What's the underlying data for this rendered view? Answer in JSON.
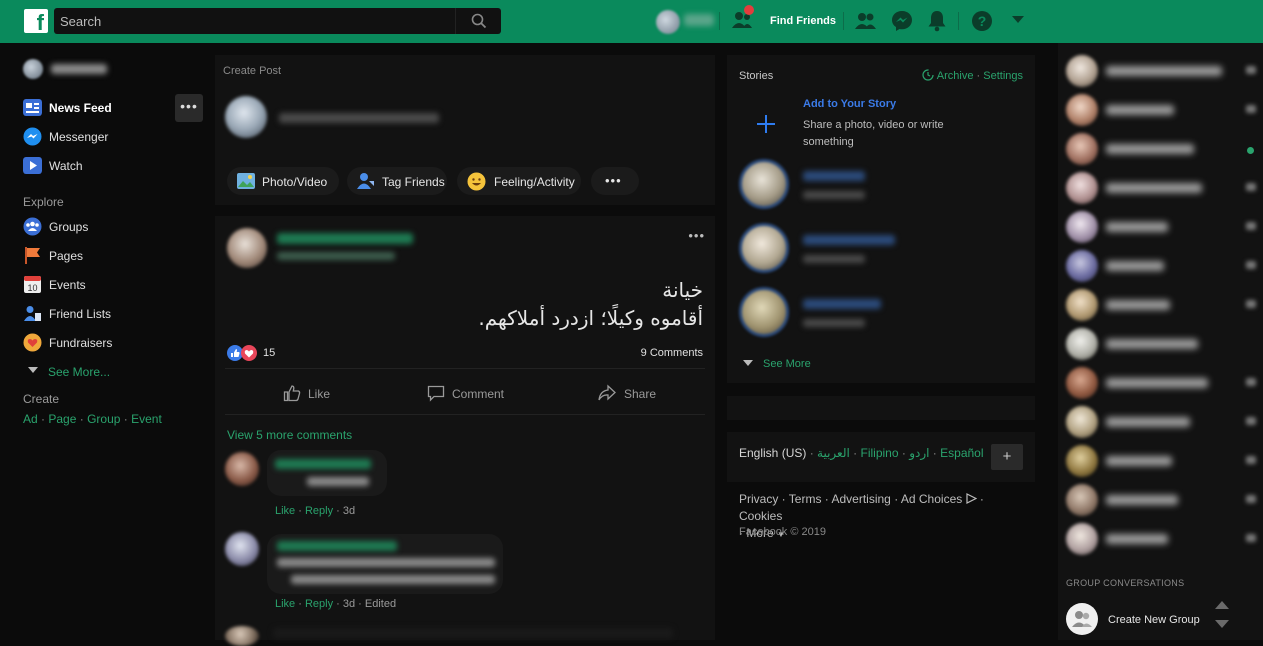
{
  "topbar": {
    "logo": "f",
    "search_placeholder": "Search",
    "find_friends": "Find Friends",
    "icons": [
      "friend-requests-icon",
      "messenger-icon",
      "notifications-icon",
      "help-icon",
      "dropdown-caret-icon"
    ],
    "colors": {
      "bar": "#0a8a5c",
      "badge": "#e23d3d"
    }
  },
  "left_sidebar": {
    "items": [
      {
        "label": "News Feed",
        "icon": "news-feed-icon"
      },
      {
        "label": "Messenger",
        "icon": "messenger-icon"
      },
      {
        "label": "Watch",
        "icon": "watch-icon"
      }
    ],
    "explore_title": "Explore",
    "explore": [
      {
        "label": "Groups",
        "icon": "groups-icon"
      },
      {
        "label": "Pages",
        "icon": "pages-flag-icon"
      },
      {
        "label": "Events",
        "icon": "events-calendar-icon"
      },
      {
        "label": "Friend Lists",
        "icon": "friend-lists-icon"
      },
      {
        "label": "Fundraisers",
        "icon": "fundraisers-icon"
      }
    ],
    "see_more": "See More...",
    "create_title": "Create",
    "create_links": [
      "Ad",
      "Page",
      "Group",
      "Event"
    ],
    "more_dots": "•••"
  },
  "create_post": {
    "title": "Create Post",
    "actions": [
      "Photo/Video",
      "Tag Friends",
      "Feeling/Activity"
    ],
    "more": "•••"
  },
  "post": {
    "text_line1": "خيانة",
    "text_line2": "أقاموه وكيلًا؛ ازدرد أملاكهم.",
    "reactions_count": "15",
    "comments_count": "9 Comments",
    "actions": [
      "Like",
      "Comment",
      "Share"
    ],
    "more": "•••",
    "view_more_comments": "View 5 more comments",
    "comments": [
      {
        "like": "Like",
        "reply": "Reply",
        "time": "3d",
        "edited": ""
      },
      {
        "like": "Like",
        "reply": "Reply",
        "time": "3d",
        "edited": "Edited"
      }
    ]
  },
  "stories": {
    "title": "Stories",
    "archive": "Archive",
    "settings": "Settings",
    "add_title": "Add to Your Story",
    "add_sub": "Share a photo, video or write something",
    "see_more": "See More"
  },
  "languages": {
    "current": "English (US)",
    "others": [
      "العربية",
      "Filipino",
      "اردو",
      "Español"
    ],
    "add": "+"
  },
  "footer": {
    "links": [
      "Privacy",
      "Terms",
      "Advertising",
      "Ad Choices",
      "Cookies",
      "More"
    ],
    "copyright": "Facebook © 2019"
  },
  "chat": {
    "group_conversations": "GROUP CONVERSATIONS",
    "create_group": "Create New Group"
  }
}
